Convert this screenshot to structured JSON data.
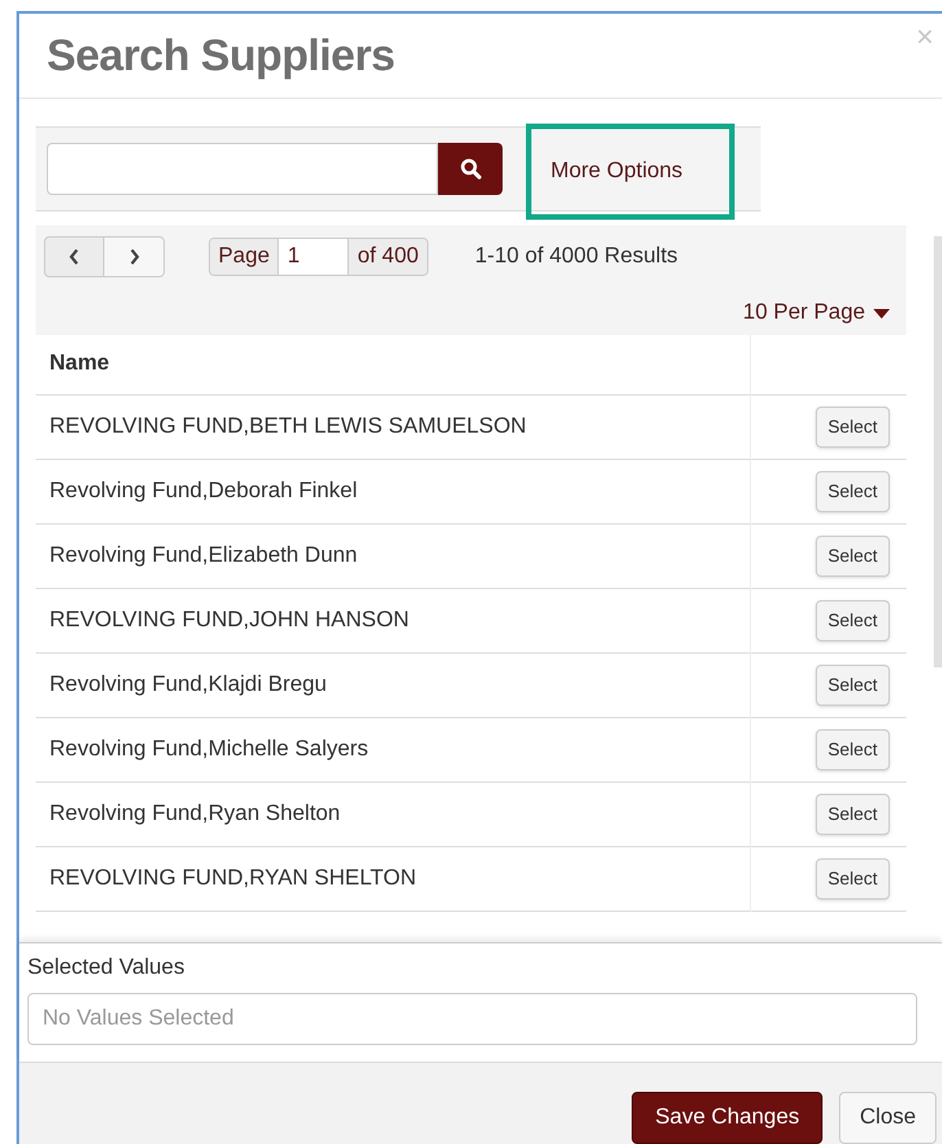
{
  "dialog": {
    "title": "Search Suppliers",
    "close": "×"
  },
  "search": {
    "more_options": "More Options"
  },
  "pagination": {
    "page_label": "Page",
    "page": "1",
    "of_pages": "of 400",
    "results": "1-10 of 4000 Results",
    "per_page": "10 Per Page"
  },
  "table": {
    "columns": [
      "Name"
    ],
    "rows": [
      {
        "name": "REVOLVING FUND,BETH LEWIS SAMUELSON",
        "action": "Select"
      },
      {
        "name": "Revolving Fund,Deborah Finkel",
        "action": "Select"
      },
      {
        "name": "Revolving Fund,Elizabeth Dunn",
        "action": "Select"
      },
      {
        "name": "REVOLVING FUND,JOHN HANSON",
        "action": "Select"
      },
      {
        "name": "Revolving Fund,Klajdi Bregu",
        "action": "Select"
      },
      {
        "name": "Revolving Fund,Michelle Salyers",
        "action": "Select"
      },
      {
        "name": "Revolving Fund,Ryan Shelton",
        "action": "Select"
      },
      {
        "name": "REVOLVING FUND,RYAN SHELTON",
        "action": "Select"
      }
    ]
  },
  "selected_values": {
    "label": "Selected Values",
    "placeholder": "No Values Selected"
  },
  "buttons": [
    "Save Changes",
    "Close"
  ]
}
